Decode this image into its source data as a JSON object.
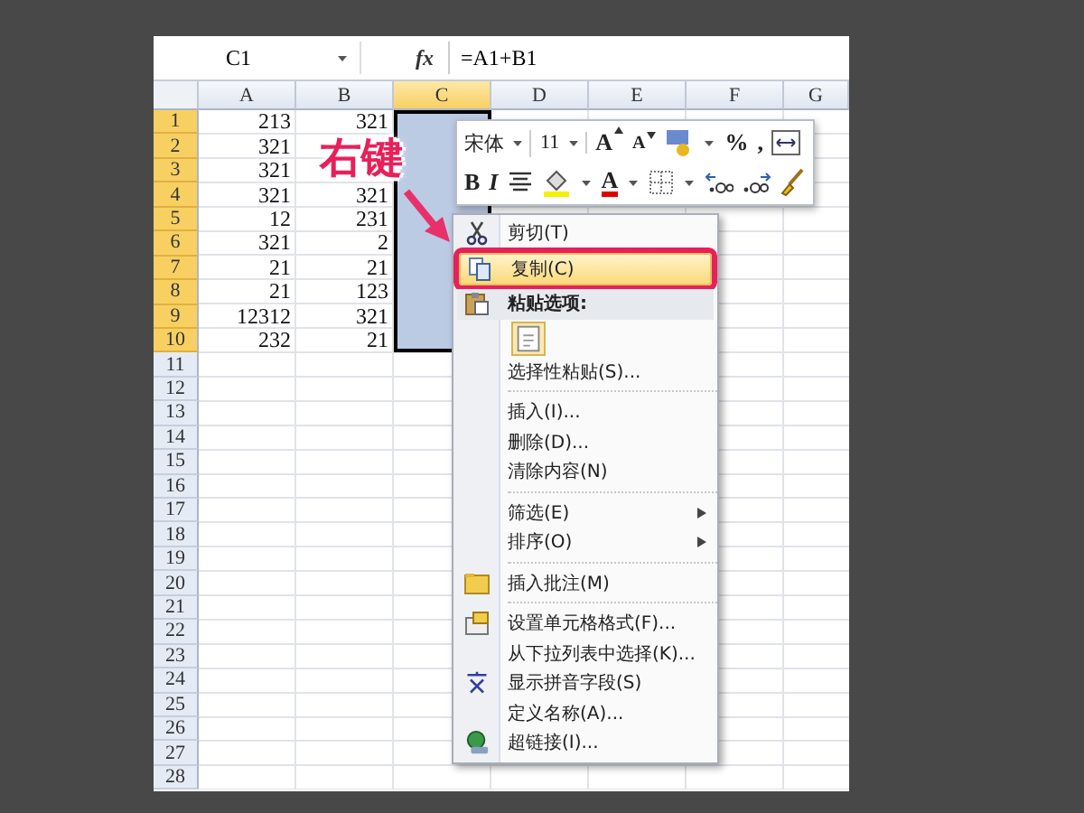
{
  "formula_bar": {
    "name_box": "C1",
    "fx": "fx",
    "formula": "=A1+B1"
  },
  "columns": [
    {
      "label": "A",
      "selected": false
    },
    {
      "label": "B",
      "selected": false
    },
    {
      "label": "C",
      "selected": true
    },
    {
      "label": "D",
      "selected": false
    },
    {
      "label": "E",
      "selected": false
    },
    {
      "label": "F",
      "selected": false
    },
    {
      "label": "G",
      "selected": false
    }
  ],
  "rows": [
    {
      "label": "1",
      "selected": true,
      "cells": [
        "213",
        "321",
        null
      ]
    },
    {
      "label": "2",
      "selected": true,
      "cells": [
        "321",
        null,
        null
      ]
    },
    {
      "label": "3",
      "selected": true,
      "cells": [
        "321",
        null,
        null
      ]
    },
    {
      "label": "4",
      "selected": true,
      "cells": [
        "321",
        "321",
        null
      ]
    },
    {
      "label": "5",
      "selected": true,
      "cells": [
        "12",
        "231",
        null
      ]
    },
    {
      "label": "6",
      "selected": true,
      "cells": [
        "321",
        "2",
        null
      ]
    },
    {
      "label": "7",
      "selected": true,
      "cells": [
        "21",
        "21",
        null
      ]
    },
    {
      "label": "8",
      "selected": true,
      "cells": [
        "21",
        "123",
        null
      ]
    },
    {
      "label": "9",
      "selected": true,
      "cells": [
        "12312",
        "321",
        null
      ]
    },
    {
      "label": "10",
      "selected": true,
      "cells": [
        "232",
        "21",
        null
      ]
    },
    {
      "label": "11",
      "selected": false
    },
    {
      "label": "12",
      "selected": false
    },
    {
      "label": "13",
      "selected": false
    },
    {
      "label": "14",
      "selected": false
    },
    {
      "label": "15",
      "selected": false
    },
    {
      "label": "16",
      "selected": false
    },
    {
      "label": "17",
      "selected": false
    },
    {
      "label": "18",
      "selected": false
    },
    {
      "label": "19",
      "selected": false
    },
    {
      "label": "20",
      "selected": false
    },
    {
      "label": "21",
      "selected": false
    },
    {
      "label": "22",
      "selected": false
    },
    {
      "label": "23",
      "selected": false
    },
    {
      "label": "24",
      "selected": false
    },
    {
      "label": "25",
      "selected": false
    },
    {
      "label": "26",
      "selected": false
    },
    {
      "label": "27",
      "selected": false
    },
    {
      "label": "28",
      "selected": false
    }
  ],
  "annotation": {
    "label": "右键"
  },
  "mini_toolbar": {
    "font_row": [
      {
        "kind": "dropdown",
        "label": "宋体"
      },
      {
        "kind": "dropdown",
        "label": "11"
      },
      {
        "kind": "grow",
        "label": "A"
      },
      {
        "kind": "shrink",
        "label": "A"
      },
      {
        "kind": "accounting"
      },
      {
        "kind": "caret"
      },
      {
        "kind": "text",
        "label": "%"
      },
      {
        "kind": "text",
        "label": ","
      },
      {
        "kind": "merge"
      }
    ],
    "format_row": [
      {
        "kind": "bold",
        "label": "B"
      },
      {
        "kind": "italic",
        "label": "I"
      },
      {
        "kind": "align"
      },
      {
        "kind": "fill"
      },
      {
        "kind": "caret"
      },
      {
        "kind": "font-color",
        "label": "A"
      },
      {
        "kind": "caret"
      },
      {
        "kind": "borders"
      },
      {
        "kind": "caret"
      },
      {
        "kind": "inc-decimal"
      },
      {
        "kind": "dec-decimal"
      },
      {
        "kind": "brush"
      }
    ]
  },
  "context_menu": {
    "items": [
      {
        "kind": "item",
        "label": "剪切(T)",
        "selected": false,
        "submenu": false
      },
      {
        "kind": "item",
        "label": "复制(C)",
        "selected": true,
        "submenu": false
      },
      {
        "kind": "header",
        "label": "粘贴选项:"
      },
      {
        "kind": "paste-icons"
      },
      {
        "kind": "item",
        "label": "选择性粘贴(S)...",
        "selected": false,
        "submenu": false
      },
      {
        "kind": "separator"
      },
      {
        "kind": "item",
        "label": "插入(I)...",
        "selected": false,
        "submenu": false
      },
      {
        "kind": "item",
        "label": "删除(D)...",
        "selected": false,
        "submenu": false
      },
      {
        "kind": "item",
        "label": "清除内容(N)",
        "selected": false,
        "submenu": false
      },
      {
        "kind": "separator"
      },
      {
        "kind": "item",
        "label": "筛选(E)",
        "selected": false,
        "submenu": true
      },
      {
        "kind": "item",
        "label": "排序(O)",
        "selected": false,
        "submenu": true
      },
      {
        "kind": "separator"
      },
      {
        "kind": "item",
        "label": "插入批注(M)",
        "selected": false,
        "submenu": false
      },
      {
        "kind": "separator"
      },
      {
        "kind": "item",
        "label": "设置单元格格式(F)...",
        "selected": false,
        "submenu": false
      },
      {
        "kind": "item",
        "label": "从下拉列表中选择(K)...",
        "selected": false,
        "submenu": false
      },
      {
        "kind": "item",
        "label": "显示拼音字段(S)",
        "selected": false,
        "submenu": false
      },
      {
        "kind": "item",
        "label": "定义名称(A)...",
        "selected": false,
        "submenu": false
      },
      {
        "kind": "item",
        "label": "超链接(I)...",
        "selected": false,
        "submenu": false
      }
    ]
  }
}
